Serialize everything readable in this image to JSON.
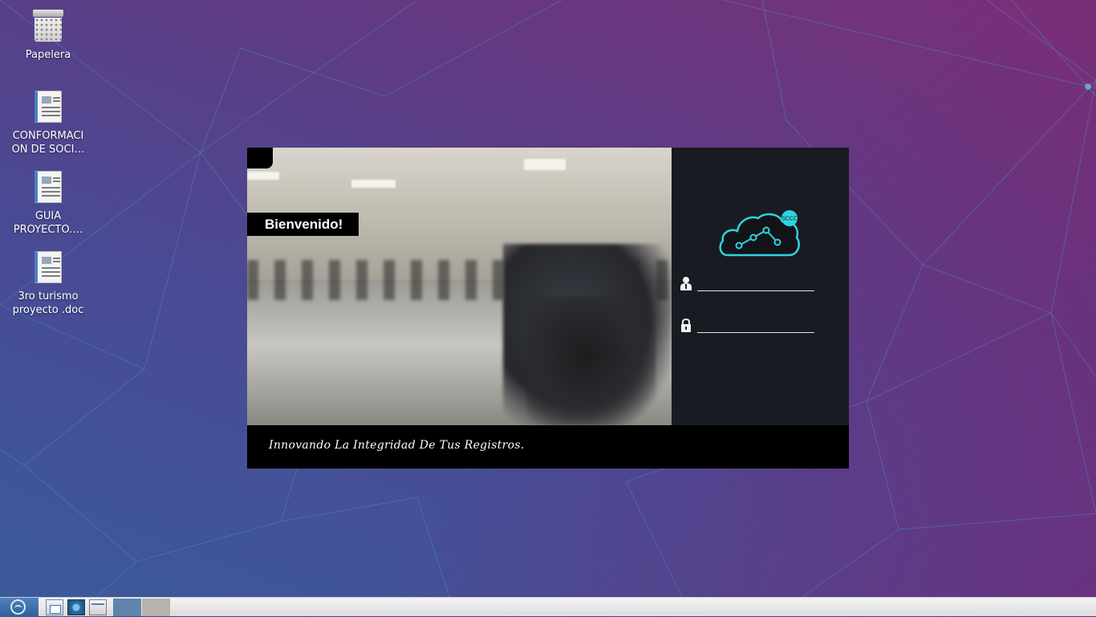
{
  "desktop": {
    "icons": [
      {
        "label": "Papelera",
        "icon": "trash-icon"
      },
      {
        "label": "CONFORMACI ON DE SOCI…",
        "icon": "document-icon"
      },
      {
        "label": "GUIA PROYECTO.…",
        "icon": "document-icon"
      },
      {
        "label": "3ro turismo proyecto .doc",
        "icon": "document-icon"
      }
    ]
  },
  "login_window": {
    "welcome": "Bienvenido!",
    "logo_badge": "SCCC",
    "username": {
      "value": "",
      "placeholder": "",
      "icon": "user-icon"
    },
    "password": {
      "value": "",
      "placeholder": "",
      "icon": "lock-icon"
    },
    "slogan": "Innovando La Integridad De Tus Registros."
  },
  "taskbar": {
    "start_icon": "start-menu-icon",
    "launchers": [
      "file-manager-icon",
      "web-browser-icon",
      "window-icon"
    ]
  },
  "colors": {
    "panel": "#181b22",
    "logo_accent": "#2fd4e0",
    "taskbar_active": "#5f84ae"
  }
}
